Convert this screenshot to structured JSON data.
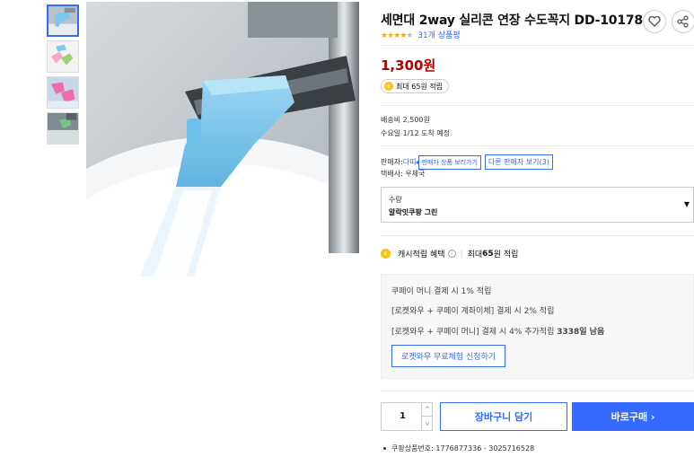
{
  "product": {
    "title": "세면대 2way 실리콘 연장 수도꼭지 DD-10178",
    "rating_stars": 4,
    "review_count": "31개 상품평",
    "price": "1,300원",
    "cash_badge": "최대 65원 적립",
    "coin_symbol": "c"
  },
  "shipping": {
    "fee": "배송비 2,500원",
    "arrival": "수요일 1/12 도착 예정"
  },
  "seller": {
    "label": "판매자: ",
    "name": "다띠",
    "seller_products_button": "판매자 상품 보러가기",
    "other_sellers_button": "다른 판매자 보기(3)",
    "carrier": "택배사: 우체국"
  },
  "option": {
    "label": "수량",
    "value": "알락잇쿠팡 그린",
    "caret": "▼"
  },
  "cash_benefit": {
    "label": "캐시적립 혜택",
    "info_icon": "i",
    "separator": "|",
    "prefix": "최대 ",
    "amount": "65",
    "suffix": "원 적립"
  },
  "benefit_box": {
    "line1": "쿠페이 머니 결제 시 1% 적립",
    "line2": "[로켓와우 + 쿠페이 계좌이체] 결제 시 2% 적립",
    "line3_prefix": "[로켓와우 + 쿠페이 머니] 결제 시 4% 추가적립 ",
    "line3_bold": "3338일 남음",
    "trial_button": "로켓와우 무료체험 신청하기"
  },
  "purchase": {
    "quantity": "1",
    "qty_up": "^",
    "qty_down": "v",
    "cart_button": "장바구니 담기",
    "buy_button": "바로구매 ›"
  },
  "product_number": "쿠팡상품번호: 1776877336 - 3025716528",
  "colors": {
    "accent": "#346aff",
    "price": "#ae0000",
    "star": "#f5a623",
    "coin": "#f5c518",
    "faucet_blue": "#7ec8ec"
  },
  "icons": [
    "heart-icon",
    "share-icon",
    "star-icon",
    "coin-icon",
    "info-icon",
    "caret-down-icon"
  ]
}
